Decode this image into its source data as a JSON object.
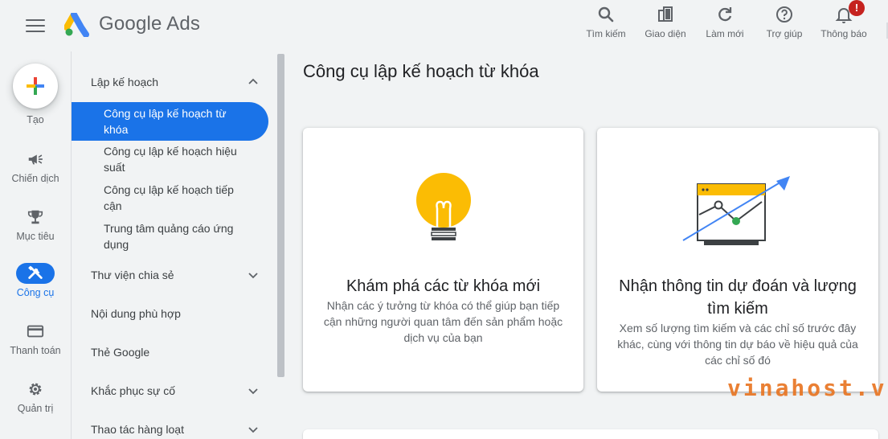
{
  "app": {
    "brand": "Google Ads"
  },
  "header": {
    "actions": [
      {
        "label": "Tìm kiếm",
        "icon": "search-icon"
      },
      {
        "label": "Giao diện",
        "icon": "appearance-icon"
      },
      {
        "label": "Làm mới",
        "icon": "refresh-icon"
      },
      {
        "label": "Trợ giúp",
        "icon": "help-icon"
      },
      {
        "label": "Thông báo",
        "icon": "bell-icon"
      }
    ],
    "notification_badge": "!"
  },
  "rail": {
    "create_label": "Tạo",
    "items": [
      {
        "label": "Chiến dịch",
        "icon": "megaphone-icon"
      },
      {
        "label": "Mục tiêu",
        "icon": "trophy-icon"
      },
      {
        "label": "Công cụ",
        "icon": "tools-icon",
        "active": true
      },
      {
        "label": "Thanh toán",
        "icon": "credit-card-icon"
      },
      {
        "label": "Quản trị",
        "icon": "gear-icon"
      }
    ]
  },
  "nav": {
    "planning": "Lập kế hoạch",
    "planning_items": [
      "Công cụ lập kế hoạch từ khóa",
      "Công cụ lập kế hoạch hiệu suất",
      "Công cụ lập kế hoạch tiếp cận",
      "Trung tâm quảng cáo ứng dụng"
    ],
    "shared_library": "Thư viện chia sẻ",
    "content_suitability": "Nội dung phù hợp",
    "google_tag": "Thẻ Google",
    "troubleshooting": "Khắc phục sự cố",
    "bulk_actions": "Thao tác hàng loạt"
  },
  "main": {
    "title": "Công cụ lập kế hoạch từ khóa",
    "cards": [
      {
        "title": "Khám phá các từ khóa mới",
        "desc": "Nhận các ý tưởng từ khóa có thể giúp bạn tiếp cận những người quan tâm đến sản phẩm hoặc dịch vụ của bạn"
      },
      {
        "title": "Nhận thông tin dự đoán và lượng tìm kiếm",
        "desc": "Xem số lượng tìm kiếm và các chỉ số trước đây khác, cùng với thông tin dự báo về hiệu quả của các chỉ số đó"
      }
    ]
  },
  "watermark": "vinahost.vn",
  "colors": {
    "accent": "#1a73e8",
    "background": "#f1f3f4",
    "bulb": "#fbbc04",
    "watermark": "#e8731f"
  }
}
